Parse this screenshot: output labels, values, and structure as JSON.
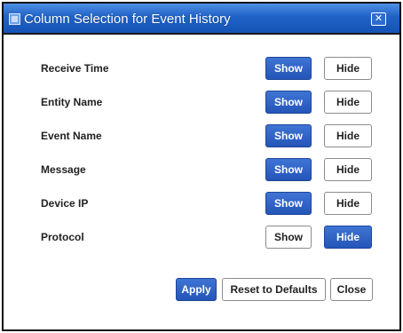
{
  "dialog": {
    "title": "Column Selection for Event History",
    "close_icon": "close-icon",
    "close_glyph": "✕"
  },
  "columns": [
    {
      "label": "Receive Time",
      "show_label": "Show",
      "hide_label": "Hide",
      "selected": "show"
    },
    {
      "label": "Entity Name",
      "show_label": "Show",
      "hide_label": "Hide",
      "selected": "show"
    },
    {
      "label": "Event Name",
      "show_label": "Show",
      "hide_label": "Hide",
      "selected": "show"
    },
    {
      "label": "Message",
      "show_label": "Show",
      "hide_label": "Hide",
      "selected": "show"
    },
    {
      "label": "Device IP",
      "show_label": "Show",
      "hide_label": "Hide",
      "selected": "show"
    },
    {
      "label": "Protocol",
      "show_label": "Show",
      "hide_label": "Hide",
      "selected": "hide"
    }
  ],
  "footer": {
    "apply_label": "Apply",
    "reset_label": "Reset to Defaults",
    "close_label": "Close"
  },
  "colors": {
    "titlebar": "#1f62c6",
    "selected_button": "#2d5fc2",
    "title_text": "#ffffff"
  }
}
